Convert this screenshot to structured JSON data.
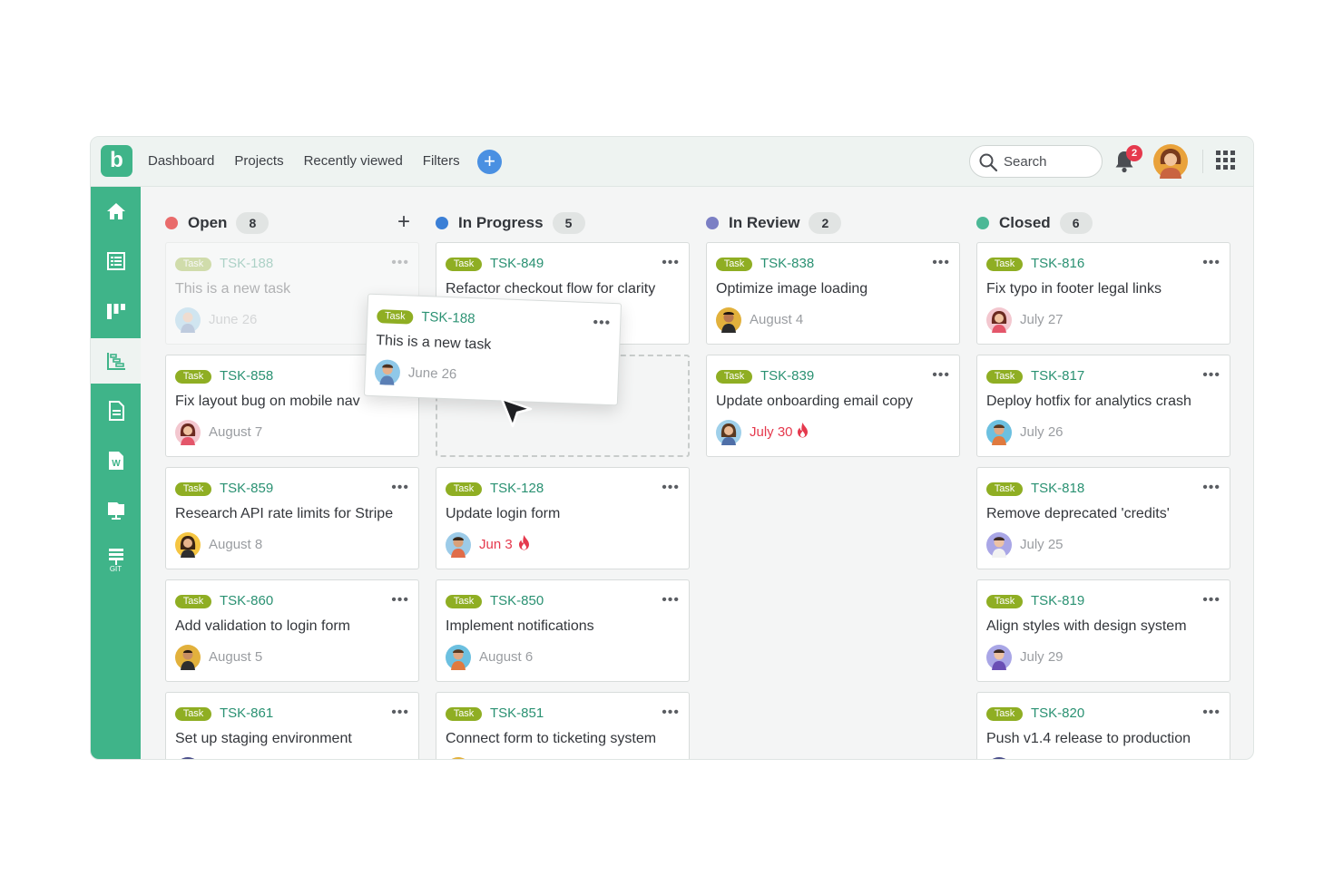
{
  "topbar": {
    "logo": "b",
    "nav": [
      "Dashboard",
      "Projects",
      "Recently viewed",
      "Filters"
    ],
    "search_placeholder": "Search",
    "notifications_count": "2"
  },
  "sidebar": {
    "items": [
      "home-icon",
      "list-icon",
      "board-icon",
      "gantt-icon",
      "document-icon",
      "word-doc-icon",
      "presentation-icon",
      "git-icon"
    ],
    "git_label": "GIT",
    "active": "gantt-icon"
  },
  "colors": {
    "brand": "#3fb489",
    "task_tag": "#8fae23",
    "task_key": "#2a9172",
    "overdue": "#e5394d",
    "open": "#e96b6b",
    "in_progress": "#3b7fd6",
    "in_review": "#7b7fc4",
    "closed": "#4cb896"
  },
  "board": {
    "columns": [
      {
        "title": "Open",
        "count": "8",
        "add_label": "+",
        "cards": [
          {
            "tag": "Task",
            "key": "TSK-188",
            "title": "This is a new task",
            "date": "June 26",
            "ghost": true
          },
          {
            "tag": "Task",
            "key": "TSK-858",
            "title": "Fix layout bug on mobile nav",
            "date": "August 7"
          },
          {
            "tag": "Task",
            "key": "TSK-859",
            "title": "Research API rate limits for Stripe",
            "date": "August 8"
          },
          {
            "tag": "Task",
            "key": "TSK-860",
            "title": "Add validation to login form",
            "date": "August 5"
          },
          {
            "tag": "Task",
            "key": "TSK-861",
            "title": "Set up staging environment",
            "date": ""
          }
        ]
      },
      {
        "title": "In Progress",
        "count": "5",
        "cards": [
          {
            "tag": "Task",
            "key": "TSK-849",
            "title": "Refactor checkout flow for clarity",
            "date": ""
          },
          {
            "tag": "Task",
            "key": "TSK-128",
            "title": "Update login form",
            "date": "Jun 3",
            "overdue": true
          },
          {
            "tag": "Task",
            "key": "TSK-850",
            "title": "Implement notifications",
            "date": "August 6"
          },
          {
            "tag": "Task",
            "key": "TSK-851",
            "title": "Connect form to ticketing system",
            "date": ""
          }
        ]
      },
      {
        "title": "In Review",
        "count": "2",
        "cards": [
          {
            "tag": "Task",
            "key": "TSK-838",
            "title": "Optimize image loading",
            "date": "August 4"
          },
          {
            "tag": "Task",
            "key": "TSK-839",
            "title": "Update onboarding email copy",
            "date": "July 30",
            "overdue": true
          }
        ]
      },
      {
        "title": "Closed",
        "count": "6",
        "cards": [
          {
            "tag": "Task",
            "key": "TSK-816",
            "title": "Fix typo in footer legal links",
            "date": "July 27"
          },
          {
            "tag": "Task",
            "key": "TSK-817",
            "title": "Deploy hotfix for analytics crash",
            "date": "July 26"
          },
          {
            "tag": "Task",
            "key": "TSK-818",
            "title": "Remove deprecated 'credits'",
            "date": "July 25"
          },
          {
            "tag": "Task",
            "key": "TSK-819",
            "title": "Align styles with design system",
            "date": "July 29"
          },
          {
            "tag": "Task",
            "key": "TSK-820",
            "title": "Push v1.4 release to production",
            "date": ""
          }
        ]
      }
    ],
    "dragging_card": {
      "tag": "Task",
      "key": "TSK-188",
      "title": "This is a new task",
      "date": "June 26"
    }
  }
}
